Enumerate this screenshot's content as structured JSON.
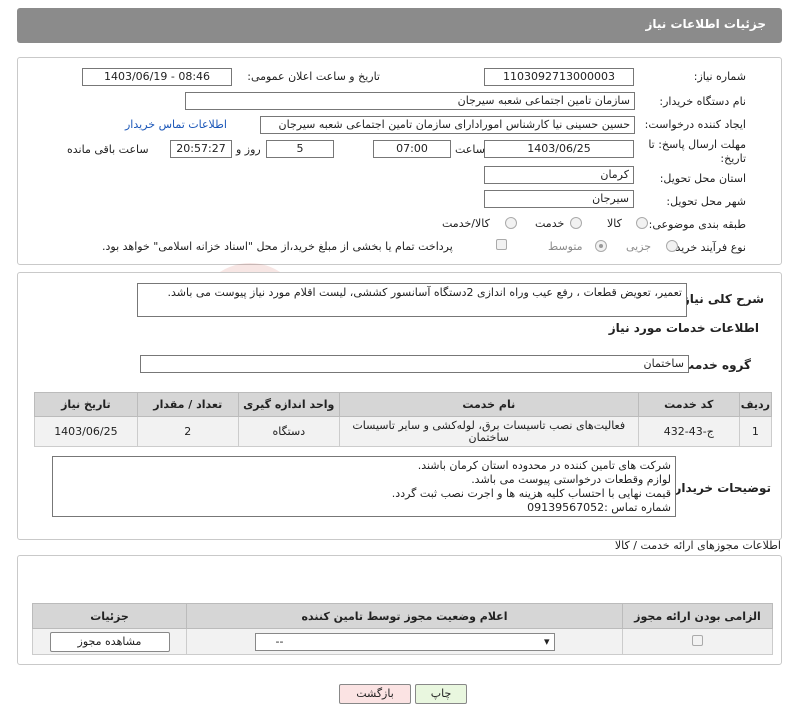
{
  "header": {
    "title": "جزئیات اطلاعات نیاز"
  },
  "form": {
    "need_number_label": "شماره نیاز:",
    "need_number": "1103092713000003",
    "announce_label": "تاریخ و ساعت اعلان عمومی:",
    "announce_value": "1403/06/19 - 08:46",
    "buyer_label": "نام دستگاه خریدار:",
    "buyer_value": "سازمان تامین اجتماعی شعبه سیرجان",
    "requester_label": "ایجاد کننده درخواست:",
    "requester_value": "حسین حسینی نیا کارشناس امورادارای سازمان تامین اجتماعی شعبه سیرجان",
    "contact_link": "اطلاعات تماس خریدار",
    "deadline_label_1": "مهلت ارسال پاسخ: تا",
    "deadline_label_2": "تاریخ:",
    "deadline_date": "1403/06/25",
    "time_label": "ساعت",
    "deadline_time": "07:00",
    "days_value": "5",
    "days_label": "روز و",
    "remaining_time": "20:57:27",
    "remaining_label": "ساعت باقی مانده",
    "province_label": "استان محل تحویل:",
    "province_value": "کرمان",
    "city_label": "شهر محل تحویل:",
    "city_value": "سیرجان",
    "category_label": "طبقه بندی موضوعی:",
    "category_options": [
      "کالا",
      "خدمت",
      "کالا/خدمت"
    ],
    "category_selected": "خدمت",
    "process_label": "نوع فرآیند خرید :",
    "process_options": [
      "جزیی",
      "متوسط"
    ],
    "process_selected": "جزیی",
    "treasury_note": "پرداخت تمام یا بخشی از مبلغ خرید،از محل \"اسناد خزانه اسلامی\" خواهد بود."
  },
  "summary": {
    "label": "شرح کلی نیاز:",
    "text": "تعمیر، تعویض قطعات ، رفع عیب وراه اندازی 2دستگاه آسانسور کششی، لیست اقلام مورد نیاز پیوست می باشد."
  },
  "services": {
    "section_title": "اطلاعات خدمات مورد نیاز",
    "group_label": "گروه خدمت:",
    "group_value": "ساختمان",
    "table": {
      "headers": [
        "ردیف",
        "کد خدمت",
        "نام خدمت",
        "واحد اندازه گیری",
        "تعداد / مقدار",
        "تاریخ نیاز"
      ],
      "rows": [
        {
          "index": "1",
          "code": "ج-43-432",
          "name": "فعالیت‌های نصب تاسیسات برق، لوله‌کشی و سایر تاسیسات ساختمان",
          "unit": "دستگاه",
          "qty": "2",
          "date": "1403/06/25"
        }
      ]
    }
  },
  "buyer_notes": {
    "label": "توضیحات خریدار:",
    "lines": [
      "شرکت های تامین کننده در محدوده استان کرمان باشند.",
      "لوازم وقطعات درخواستی پیوست می باشد.",
      "قیمت نهایی با احتساب کلیه هزینه ها و اجرت نصب ثبت گردد.",
      "شماره تماس :09139567052"
    ]
  },
  "permits": {
    "section_title": "اطلاعات مجوزهای ارائه خدمت / کالا",
    "headers": [
      "الزامی بودن ارائه مجوز",
      "اعلام وضعیت مجوز توسط تامین کننده",
      "جزئیات"
    ],
    "select_value": "--",
    "view_button": "مشاهده مجوز"
  },
  "buttons": {
    "print": "چاپ",
    "back": "بازگشت"
  },
  "colors": {
    "header_bg": "#8b8b8b",
    "link": "#1a56b8",
    "print_bg": "#e9f7df",
    "back_bg": "#fbe3e3"
  }
}
